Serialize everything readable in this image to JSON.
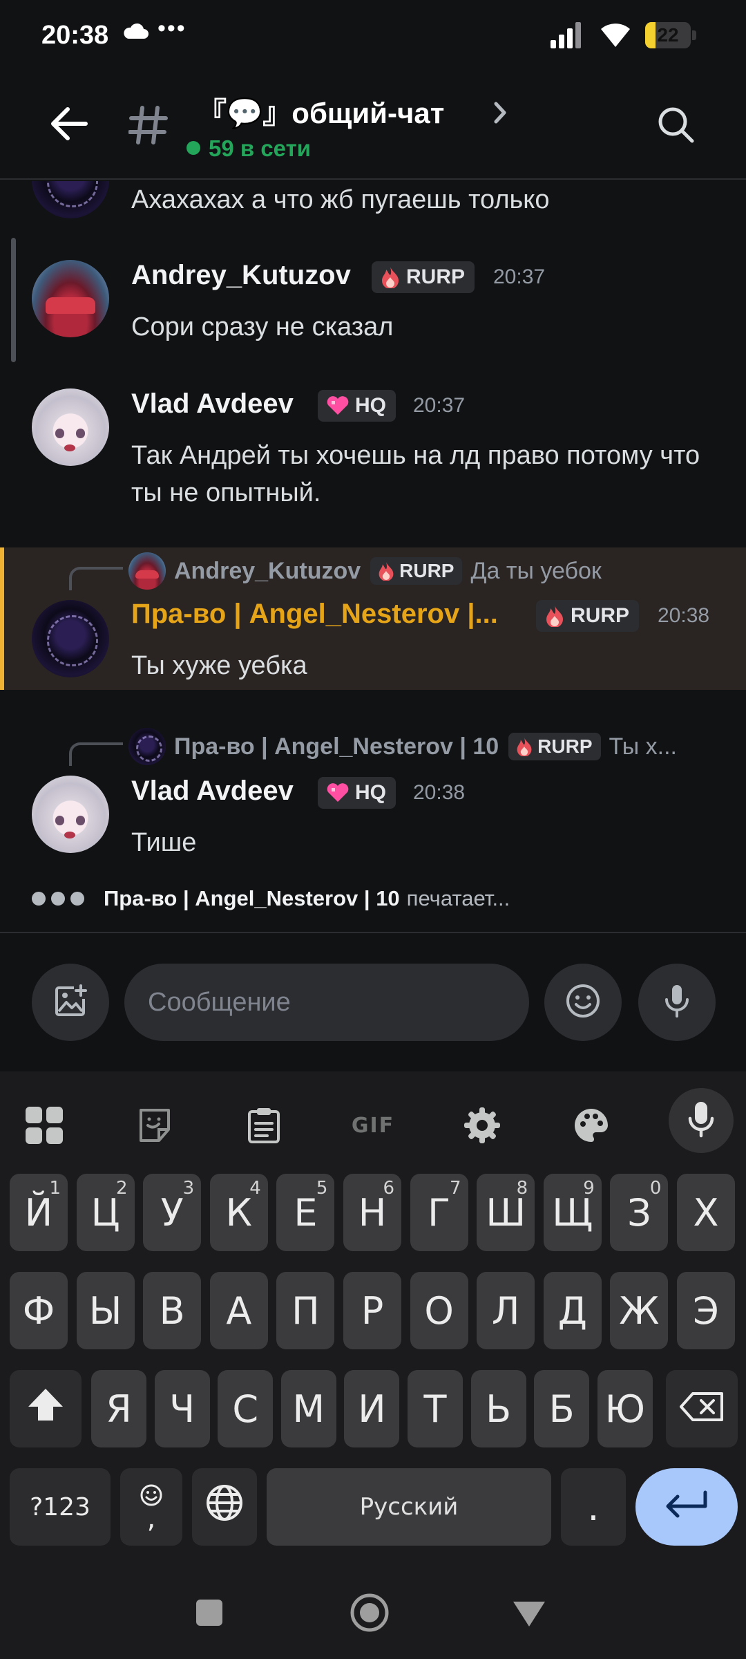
{
  "status_bar": {
    "time": "20:38",
    "dots": "•••",
    "battery": "22",
    "battery_level": 0.22
  },
  "header": {
    "channel_title": "『💬』общий-чат",
    "online_status": "59 в сети"
  },
  "messages": [
    {
      "id": "m0",
      "text": "Ахахахах а что жб пугаешь только"
    },
    {
      "id": "m1",
      "author": "Andrey_Kutuzov",
      "tag": "RURP",
      "time": "20:37",
      "text": "Сори сразу не сказал"
    },
    {
      "id": "m2",
      "author": "Vlad Avdeev",
      "tag": "HQ",
      "time": "20:37",
      "text": "Так Андрей ты хочешь на лд право потому что ты не опытный."
    },
    {
      "id": "m3",
      "author": "Пра-во | Angel_Nesterov |...",
      "tag": "RURP",
      "time": "20:38",
      "text": "Ты хуже уебка",
      "reply": {
        "author": "Andrey_Kutuzov",
        "tag": "RURP",
        "text": "Да ты уебок"
      }
    },
    {
      "id": "m4",
      "author": "Vlad Avdeev",
      "tag": "HQ",
      "time": "20:38",
      "text": "Тише",
      "reply": {
        "author": "Пра-во | Angel_Nesterov | 10",
        "tag": "RURP",
        "text": "Ты х..."
      }
    }
  ],
  "typing": {
    "user": "Пра-во | Angel_Nesterov | 10",
    "suffix": "печатает..."
  },
  "composer": {
    "placeholder": "Сообщение"
  },
  "keyboard": {
    "row1": [
      {
        "k": "Й",
        "n": "1"
      },
      {
        "k": "Ц",
        "n": "2"
      },
      {
        "k": "У",
        "n": "3"
      },
      {
        "k": "К",
        "n": "4"
      },
      {
        "k": "Е",
        "n": "5"
      },
      {
        "k": "Н",
        "n": "6"
      },
      {
        "k": "Г",
        "n": "7"
      },
      {
        "k": "Ш",
        "n": "8"
      },
      {
        "k": "Щ",
        "n": "9"
      },
      {
        "k": "З",
        "n": "0"
      },
      {
        "k": "Х",
        "n": ""
      }
    ],
    "row2": [
      "Ф",
      "Ы",
      "В",
      "А",
      "П",
      "Р",
      "О",
      "Л",
      "Д",
      "Ж",
      "Э"
    ],
    "row3": [
      "Я",
      "Ч",
      "С",
      "М",
      "И",
      "Т",
      "Ь",
      "Б",
      "Ю"
    ],
    "symbols_label": "?123",
    "emoji_comma": ",",
    "space_label": "Русский",
    "period": ".",
    "gif_label": "GIF"
  }
}
